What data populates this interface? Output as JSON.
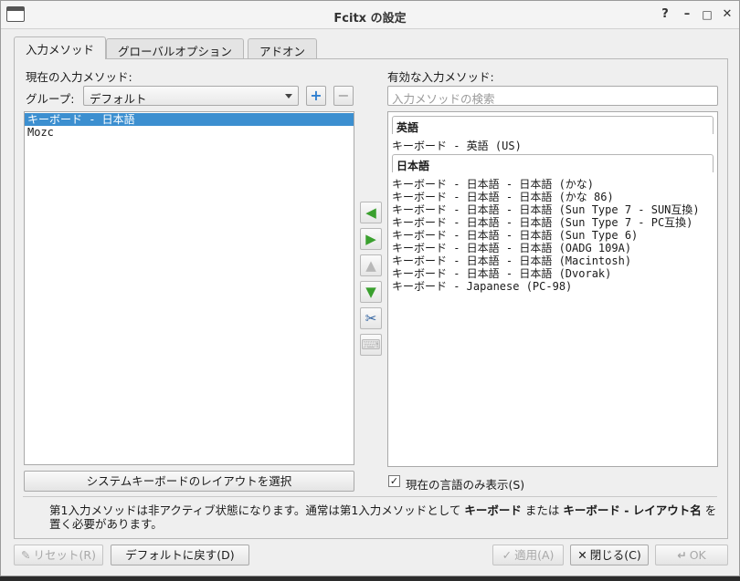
{
  "window": {
    "title": "Fcitx の設定",
    "controls": {
      "help": "?",
      "minimize": "–",
      "maximize": "□",
      "close": "✕"
    }
  },
  "tabs": [
    "入力メソッド",
    "グローバルオプション",
    "アドオン"
  ],
  "left": {
    "current_label": "現在の入力メソッド:",
    "group_label": "グループ:",
    "group_value": "デフォルト",
    "add": "+",
    "remove": "−",
    "items": [
      "キーボード - 日本語",
      "Mozc"
    ],
    "select_layout_button": "システムキーボードのレイアウトを選択"
  },
  "right": {
    "available_label": "有効な入力メソッド:",
    "search_placeholder": "入力メソッドの検索",
    "groups": [
      {
        "header": "英語",
        "items": [
          "キーボード - 英語 (US)"
        ]
      },
      {
        "header": "日本語",
        "items": [
          "キーボード - 日本語 - 日本語 (かな)",
          "キーボード - 日本語 - 日本語 (かな 86)",
          "キーボード - 日本語 - 日本語 (Sun Type 7 - SUN互換)",
          "キーボード - 日本語 - 日本語 (Sun Type 7 - PC互換)",
          "キーボード - 日本語 - 日本語 (Sun Type 6)",
          "キーボード - 日本語 - 日本語 (OADG 109A)",
          "キーボード - 日本語 - 日本語 (Macintosh)",
          "キーボード - 日本語 - 日本語 (Dvorak)",
          "キーボード - Japanese (PC-98)"
        ]
      }
    ],
    "only_current_language": "現在の言語のみ表示(S)",
    "only_current_language_checked": true
  },
  "info": {
    "text1": "第1入力メソッドは非アクティブ状態になります。通常は第1入力メソッドとして ",
    "bold1": "キーボード",
    "text2": " または ",
    "bold2": "キーボード - レイアウト名",
    "text3": " を置く必要があります。"
  },
  "buttons": {
    "reset": "リセット(R)",
    "default": "デフォルトに戻す(D)",
    "apply": "適用(A)",
    "close": "閉じる(C)",
    "ok": "OK"
  },
  "colors": {
    "selection": "#3c8fd0",
    "arrow_green": "#3aa02e"
  },
  "icons": {
    "move_left": "arrow-left-icon",
    "move_right": "arrow-right-icon",
    "move_up": "arrow-up-icon",
    "move_down": "arrow-down-icon",
    "configure": "tools-icon",
    "layout": "keyboard-layout-icon"
  }
}
